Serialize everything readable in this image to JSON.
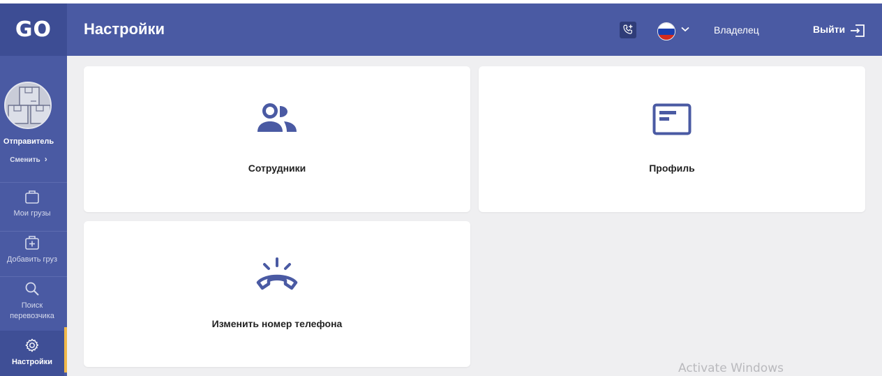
{
  "app": {
    "logo": "GO"
  },
  "header": {
    "title": "Настройки",
    "role": "Владелец",
    "logout_label": "Выйти",
    "language_flag": "RU"
  },
  "sidebar": {
    "user_role": "Отправитель",
    "change_label": "Сменить",
    "items": [
      {
        "label": "Мои грузы",
        "icon": "briefcase-icon"
      },
      {
        "label": "Добавить груз",
        "icon": "add-cargo-icon"
      },
      {
        "label": "Поиск перевозчика",
        "icon": "search-icon"
      },
      {
        "label": "Настройки",
        "icon": "gear-icon",
        "active": true
      }
    ]
  },
  "cards": [
    {
      "label": "Сотрудники",
      "icon": "users-icon"
    },
    {
      "label": "Профиль",
      "icon": "profile-card-icon"
    },
    {
      "label": "Изменить номер телефона",
      "icon": "phone-ringing-icon"
    }
  ],
  "watermark": "Activate Windows",
  "colors": {
    "primary": "#4a5aa3",
    "accent": "#f0b84a",
    "background": "#efeff1",
    "icon": "#4a5aa3"
  }
}
